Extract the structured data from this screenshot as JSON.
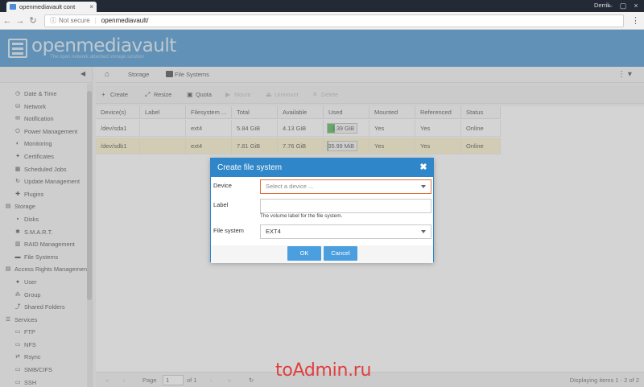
{
  "browser": {
    "tab_title": "openmediavault cont",
    "user": "Derrik",
    "security_label": "Not secure",
    "url": "openmediavault/",
    "separator": "|"
  },
  "app": {
    "logo_text": "openmediavault",
    "tagline": "The open network attached storage solution"
  },
  "sidebar": {
    "items": [
      {
        "label": "Date & Time",
        "kind": "child",
        "icon": "clock-icon"
      },
      {
        "label": "Network",
        "kind": "child",
        "icon": "network-icon"
      },
      {
        "label": "Notification",
        "kind": "child",
        "icon": "mail-icon"
      },
      {
        "label": "Power Management",
        "kind": "child",
        "icon": "power-icon"
      },
      {
        "label": "Monitoring",
        "kind": "child",
        "icon": "monitoring-icon"
      },
      {
        "label": "Certificates",
        "kind": "child",
        "icon": "certificate-icon"
      },
      {
        "label": "Scheduled Jobs",
        "kind": "child",
        "icon": "calendar-icon"
      },
      {
        "label": "Update Management",
        "kind": "child",
        "icon": "refresh-icon"
      },
      {
        "label": "Plugins",
        "kind": "child",
        "icon": "puzzle-icon"
      },
      {
        "label": "Storage",
        "kind": "cat",
        "icon": "database-icon"
      },
      {
        "label": "Disks",
        "kind": "child",
        "icon": "disk-icon"
      },
      {
        "label": "S.M.A.R.T.",
        "kind": "child",
        "icon": "smart-icon"
      },
      {
        "label": "RAID Management",
        "kind": "child",
        "icon": "raid-icon"
      },
      {
        "label": "File Systems",
        "kind": "child",
        "icon": "filesystem-icon"
      },
      {
        "label": "Access Rights Management",
        "kind": "cat",
        "icon": "id-card-icon"
      },
      {
        "label": "User",
        "kind": "child",
        "icon": "user-icon"
      },
      {
        "label": "Group",
        "kind": "child",
        "icon": "group-icon"
      },
      {
        "label": "Shared Folders",
        "kind": "child",
        "icon": "share-icon"
      },
      {
        "label": "Services",
        "kind": "cat",
        "icon": "services-icon"
      },
      {
        "label": "FTP",
        "kind": "child",
        "icon": "ftp-icon"
      },
      {
        "label": "NFS",
        "kind": "child",
        "icon": "nfs-icon"
      },
      {
        "label": "Rsync",
        "kind": "child",
        "icon": "rsync-icon"
      },
      {
        "label": "SMB/CIFS",
        "kind": "child",
        "icon": "smb-icon"
      },
      {
        "label": "SSH",
        "kind": "child",
        "icon": "terminal-icon"
      }
    ]
  },
  "breadcrumb": {
    "storage": "Storage",
    "file_systems": "File Systems"
  },
  "toolbar": {
    "create": "Create",
    "resize": "Resize",
    "quota": "Quota",
    "mount": "Mount",
    "unmount": "Unmount",
    "delete": "Delete"
  },
  "grid": {
    "headers": [
      "Device(s)",
      "Label",
      "Filesystem ...",
      "Total",
      "Available",
      "Used",
      "Mounted",
      "Referenced",
      "Status"
    ],
    "rows": [
      {
        "device": "/dev/sda1",
        "label": "",
        "filesystem": "ext4",
        "total": "5.84 GiB",
        "available": "4.13 GiB",
        "used": "1.39 GiB",
        "used_fraction": 0.24,
        "mounted": "Yes",
        "referenced": "Yes",
        "status": "Online"
      },
      {
        "device": "/dev/sdb1",
        "label": "",
        "filesystem": "ext4",
        "total": "7.81 GiB",
        "available": "7.76 GiB",
        "used": "35.99 MiB",
        "used_fraction": 0.005,
        "mounted": "Yes",
        "referenced": "Yes",
        "status": "Online"
      }
    ]
  },
  "pager": {
    "page_label": "Page",
    "page_value": "1",
    "of_label": "of 1",
    "display": "Displaying items 1 - 2 of 2"
  },
  "dialog": {
    "title": "Create file system",
    "device_label": "Device",
    "device_placeholder": "Select a device ...",
    "label_label": "Label",
    "label_value": "",
    "label_hint": "The volume label for the file system.",
    "fs_label": "File system",
    "fs_value": "EXT4",
    "ok": "OK",
    "cancel": "Cancel"
  },
  "watermark": "toAdmin.ru",
  "colors": {
    "accent": "#2f86c8",
    "selected_row": "#fbf0c5",
    "used_bar": "#3db041",
    "focus_border": "#e0703a"
  }
}
